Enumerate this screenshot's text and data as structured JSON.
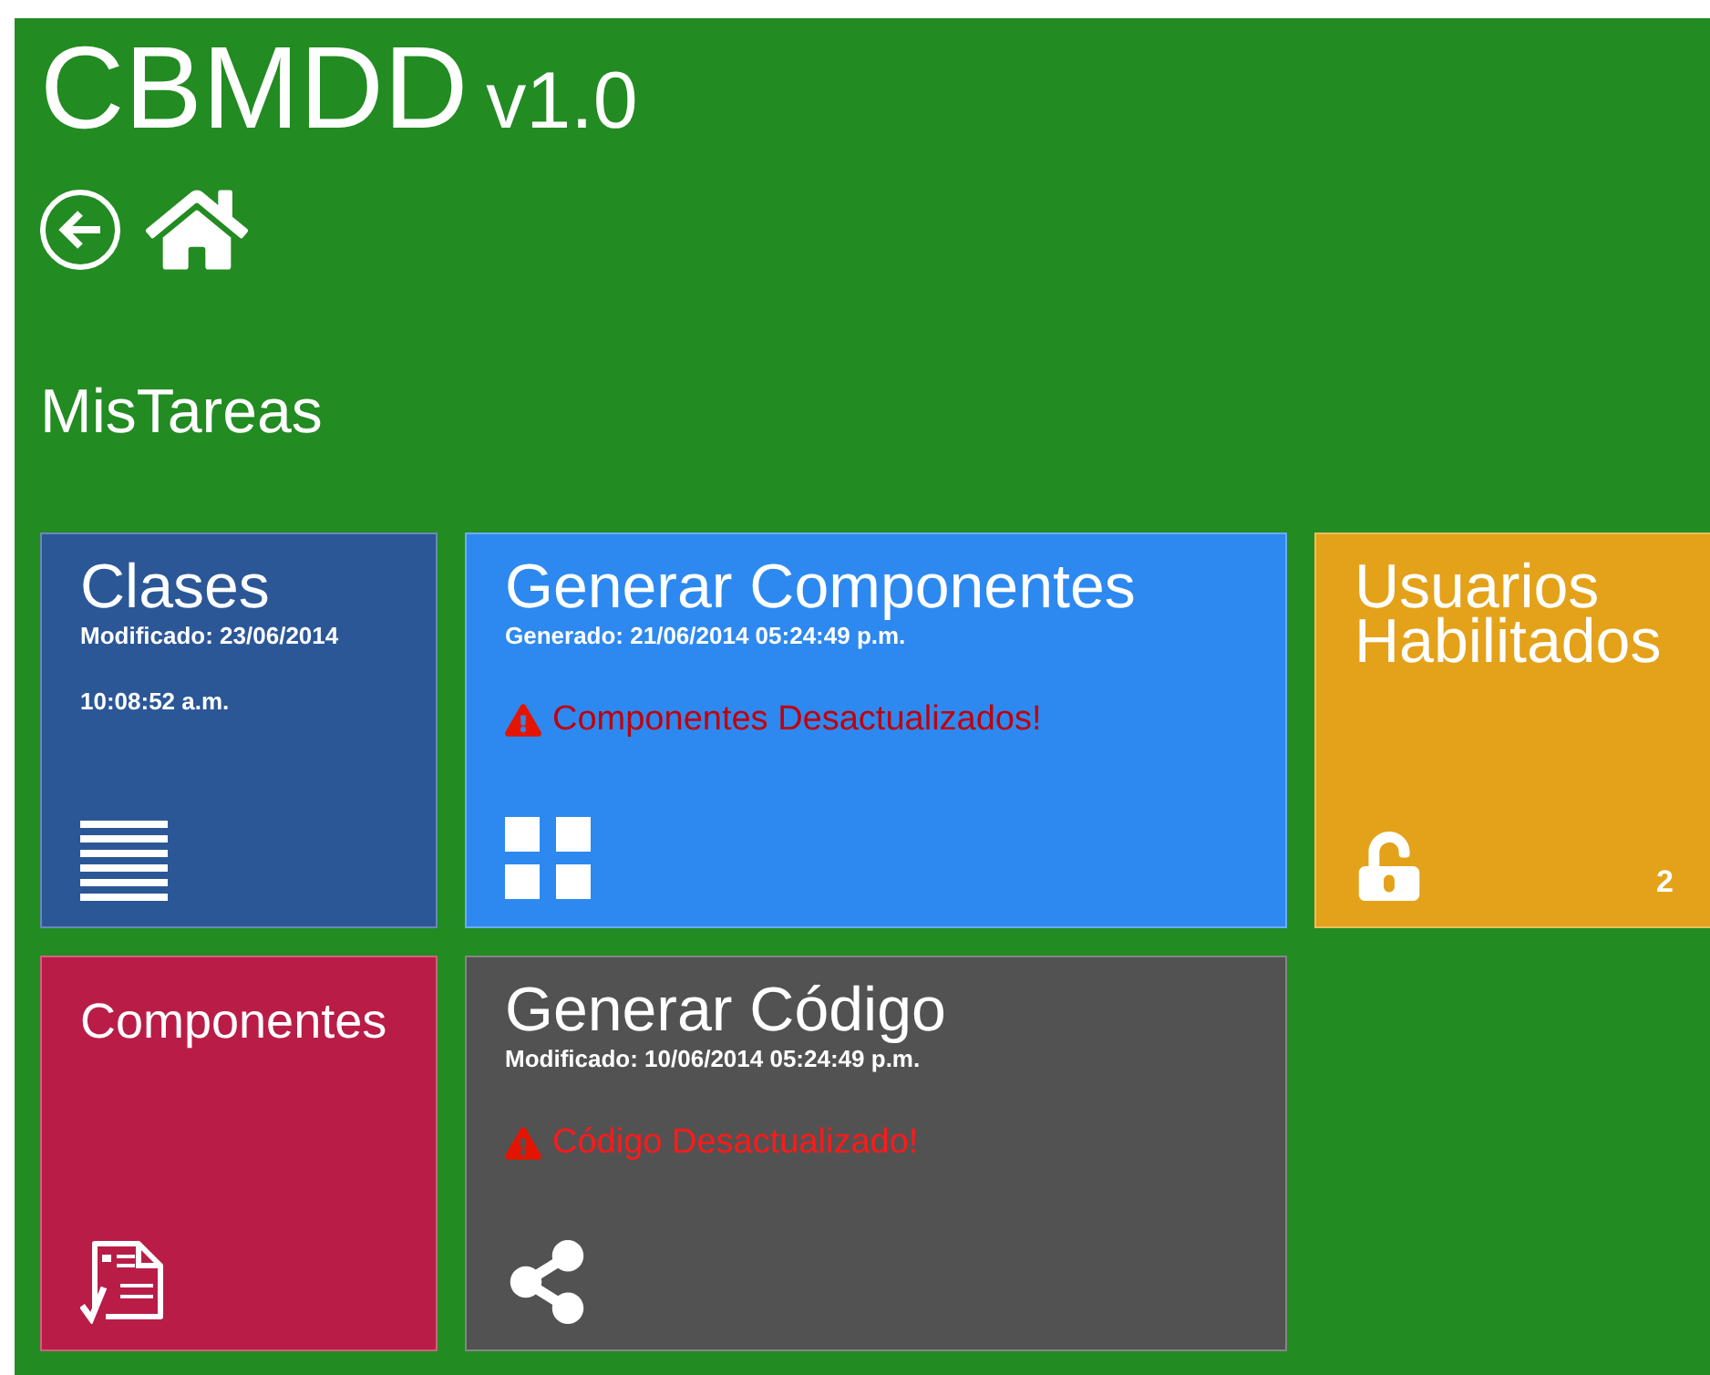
{
  "app": {
    "title": "CBMDD",
    "version": "v1.0"
  },
  "section_title": "MisTareas",
  "tiles": [
    {
      "title": "Clases",
      "subtitle": "Modificado: 23/06/2014 10:08:52 a.m.",
      "color": "#2b5797"
    },
    {
      "title": "Generar Componentes",
      "subtitle": "Generado: 21/06/2014 05:24:49 p.m.",
      "warning": "Componentes Desactualizados!",
      "color": "#2d89ef"
    },
    {
      "title": "Usuarios Habilitados",
      "color": "#e3a21a",
      "count": "2"
    },
    {
      "title": "Componentes",
      "color": "#b91d47"
    },
    {
      "title": "Generar Código",
      "subtitle": "Modificado: 10/06/2014 05:24:49 p.m.",
      "warning": "Código Desactualizado!",
      "color": "#525252"
    }
  ]
}
